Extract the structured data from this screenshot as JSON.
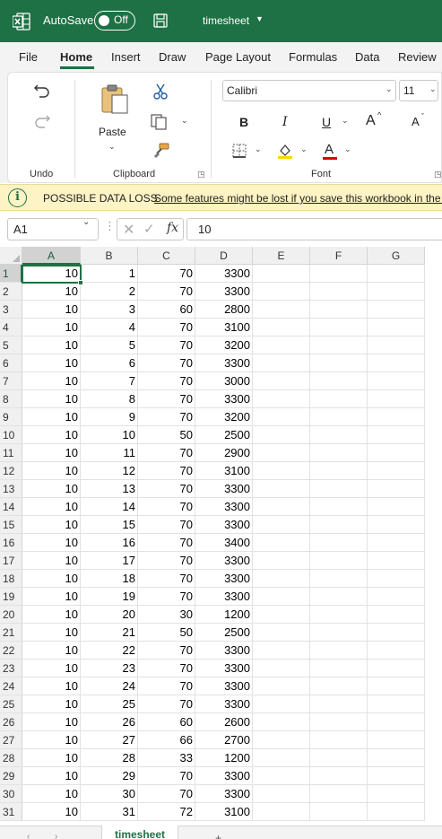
{
  "titlebar": {
    "autosave_label": "AutoSave",
    "autosave_state": "Off",
    "document_title": "timesheet",
    "background": "#1e7145"
  },
  "menu": {
    "tabs": [
      "File",
      "Home",
      "Insert",
      "Draw",
      "Page Layout",
      "Formulas",
      "Data",
      "Review"
    ],
    "active": "Home"
  },
  "ribbon": {
    "undo_group": {
      "label": "Undo",
      "icons": [
        "undo-icon",
        "redo-icon"
      ]
    },
    "clipboard_group": {
      "label": "Clipboard",
      "paste_label": "Paste",
      "icons": [
        "paste-icon",
        "cut-icon",
        "copy-icon",
        "format-painter-icon"
      ]
    },
    "font_group": {
      "label": "Font",
      "font_name": "Calibri",
      "font_size": "11",
      "bold": "B",
      "italic": "I",
      "underline": "U",
      "grow": "A",
      "shrink": "A",
      "font_color": "A",
      "fill_color_hex": "#ffd700",
      "font_color_hex": "#e00000"
    }
  },
  "infobar": {
    "title": "POSSIBLE DATA LOSS",
    "message": "Some features might be lost if you save this workbook in the c"
  },
  "formula_bar": {
    "name_box": "A1",
    "value": "10",
    "fx": "fx"
  },
  "sheet": {
    "columns": [
      "A",
      "B",
      "C",
      "D",
      "E",
      "F",
      "G"
    ],
    "selected_cell": "A1",
    "rows": [
      [
        "10",
        "1",
        "70",
        "3300"
      ],
      [
        "10",
        "2",
        "70",
        "3300"
      ],
      [
        "10",
        "3",
        "60",
        "2800"
      ],
      [
        "10",
        "4",
        "70",
        "3100"
      ],
      [
        "10",
        "5",
        "70",
        "3200"
      ],
      [
        "10",
        "6",
        "70",
        "3300"
      ],
      [
        "10",
        "7",
        "70",
        "3000"
      ],
      [
        "10",
        "8",
        "70",
        "3300"
      ],
      [
        "10",
        "9",
        "70",
        "3200"
      ],
      [
        "10",
        "10",
        "50",
        "2500"
      ],
      [
        "10",
        "11",
        "70",
        "2900"
      ],
      [
        "10",
        "12",
        "70",
        "3100"
      ],
      [
        "10",
        "13",
        "70",
        "3300"
      ],
      [
        "10",
        "14",
        "70",
        "3300"
      ],
      [
        "10",
        "15",
        "70",
        "3300"
      ],
      [
        "10",
        "16",
        "70",
        "3400"
      ],
      [
        "10",
        "17",
        "70",
        "3300"
      ],
      [
        "10",
        "18",
        "70",
        "3300"
      ],
      [
        "10",
        "19",
        "70",
        "3300"
      ],
      [
        "10",
        "20",
        "30",
        "1200"
      ],
      [
        "10",
        "21",
        "50",
        "2500"
      ],
      [
        "10",
        "22",
        "70",
        "3300"
      ],
      [
        "10",
        "23",
        "70",
        "3300"
      ],
      [
        "10",
        "24",
        "70",
        "3300"
      ],
      [
        "10",
        "25",
        "70",
        "3300"
      ],
      [
        "10",
        "26",
        "60",
        "2600"
      ],
      [
        "10",
        "27",
        "66",
        "2700"
      ],
      [
        "10",
        "28",
        "33",
        "1200"
      ],
      [
        "10",
        "29",
        "70",
        "3300"
      ],
      [
        "10",
        "30",
        "70",
        "3300"
      ],
      [
        "10",
        "31",
        "72",
        "3100"
      ]
    ]
  },
  "sheet_tabs": {
    "tabs": [
      "timesheet"
    ],
    "active": "timesheet",
    "add_label": "+"
  }
}
